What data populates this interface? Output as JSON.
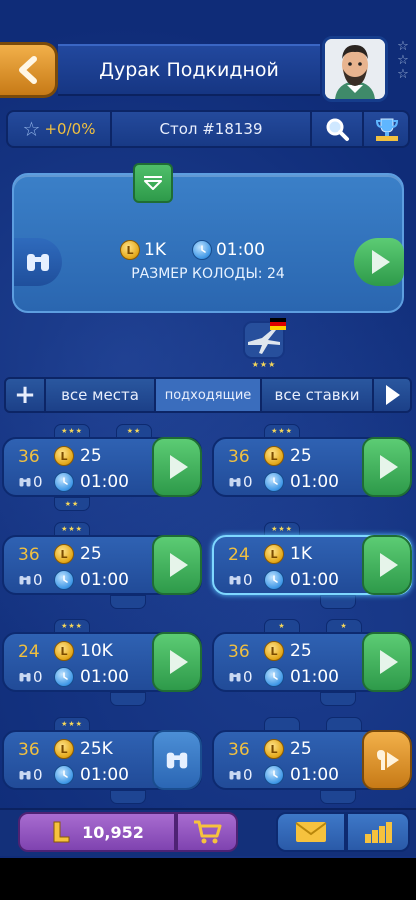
{
  "header": {
    "title": "Дурак Подкидной",
    "back_icon": "chevron-left-icon",
    "player_stars": [
      "☆",
      "☆",
      "☆"
    ],
    "accent_color": "#f0a12c"
  },
  "info_bar": {
    "rating": "+0/0%",
    "table": "Стол #18139"
  },
  "current_game": {
    "stake": "1K",
    "time": "01:00",
    "deck_size_label": "РАЗМЕР КОЛОДЫ: 24",
    "player_rank_stars": "★★★"
  },
  "filters": {
    "plus": "+",
    "all_places": "все места",
    "suitable": "подходящие",
    "all_stakes": "все ставки",
    "selected": "подходящие"
  },
  "rooms": [
    {
      "players": "36",
      "stake": "25",
      "observers": "0",
      "time": "01:00",
      "action": "play",
      "top_tabs": [
        "★★★",
        "★★"
      ],
      "bottom_tabs": [
        "★★"
      ],
      "selected": false
    },
    {
      "players": "36",
      "stake": "25",
      "observers": "0",
      "time": "01:00",
      "action": "play",
      "top_tabs": [
        "★★★"
      ],
      "bottom_tabs": [],
      "selected": false
    },
    {
      "players": "36",
      "stake": "25",
      "observers": "0",
      "time": "01:00",
      "action": "play",
      "top_tabs": [
        "★★★"
      ],
      "bottom_tabs": [
        ""
      ],
      "selected": false
    },
    {
      "players": "24",
      "stake": "1K",
      "observers": "0",
      "time": "01:00",
      "action": "play",
      "top_tabs": [
        "★★★"
      ],
      "bottom_tabs": [
        ""
      ],
      "selected": true
    },
    {
      "players": "24",
      "stake": "10K",
      "observers": "0",
      "time": "01:00",
      "action": "play",
      "top_tabs": [
        "★★★"
      ],
      "bottom_tabs": [
        ""
      ],
      "selected": false
    },
    {
      "players": "36",
      "stake": "25",
      "observers": "0",
      "time": "01:00",
      "action": "play",
      "top_tabs": [
        "★",
        "★"
      ],
      "bottom_tabs": [
        ""
      ],
      "selected": false
    },
    {
      "players": "36",
      "stake": "25K",
      "observers": "0",
      "time": "01:00",
      "action": "watch",
      "top_tabs": [
        "★★★"
      ],
      "bottom_tabs": [
        ""
      ],
      "selected": false
    },
    {
      "players": "36",
      "stake": "25",
      "observers": "0",
      "time": "01:00",
      "action": "continue",
      "top_tabs": [
        "",
        ""
      ],
      "bottom_tabs": [
        ""
      ],
      "selected": false
    }
  ],
  "footer": {
    "balance": "10,952",
    "currency_icon": "coin-L-icon"
  }
}
